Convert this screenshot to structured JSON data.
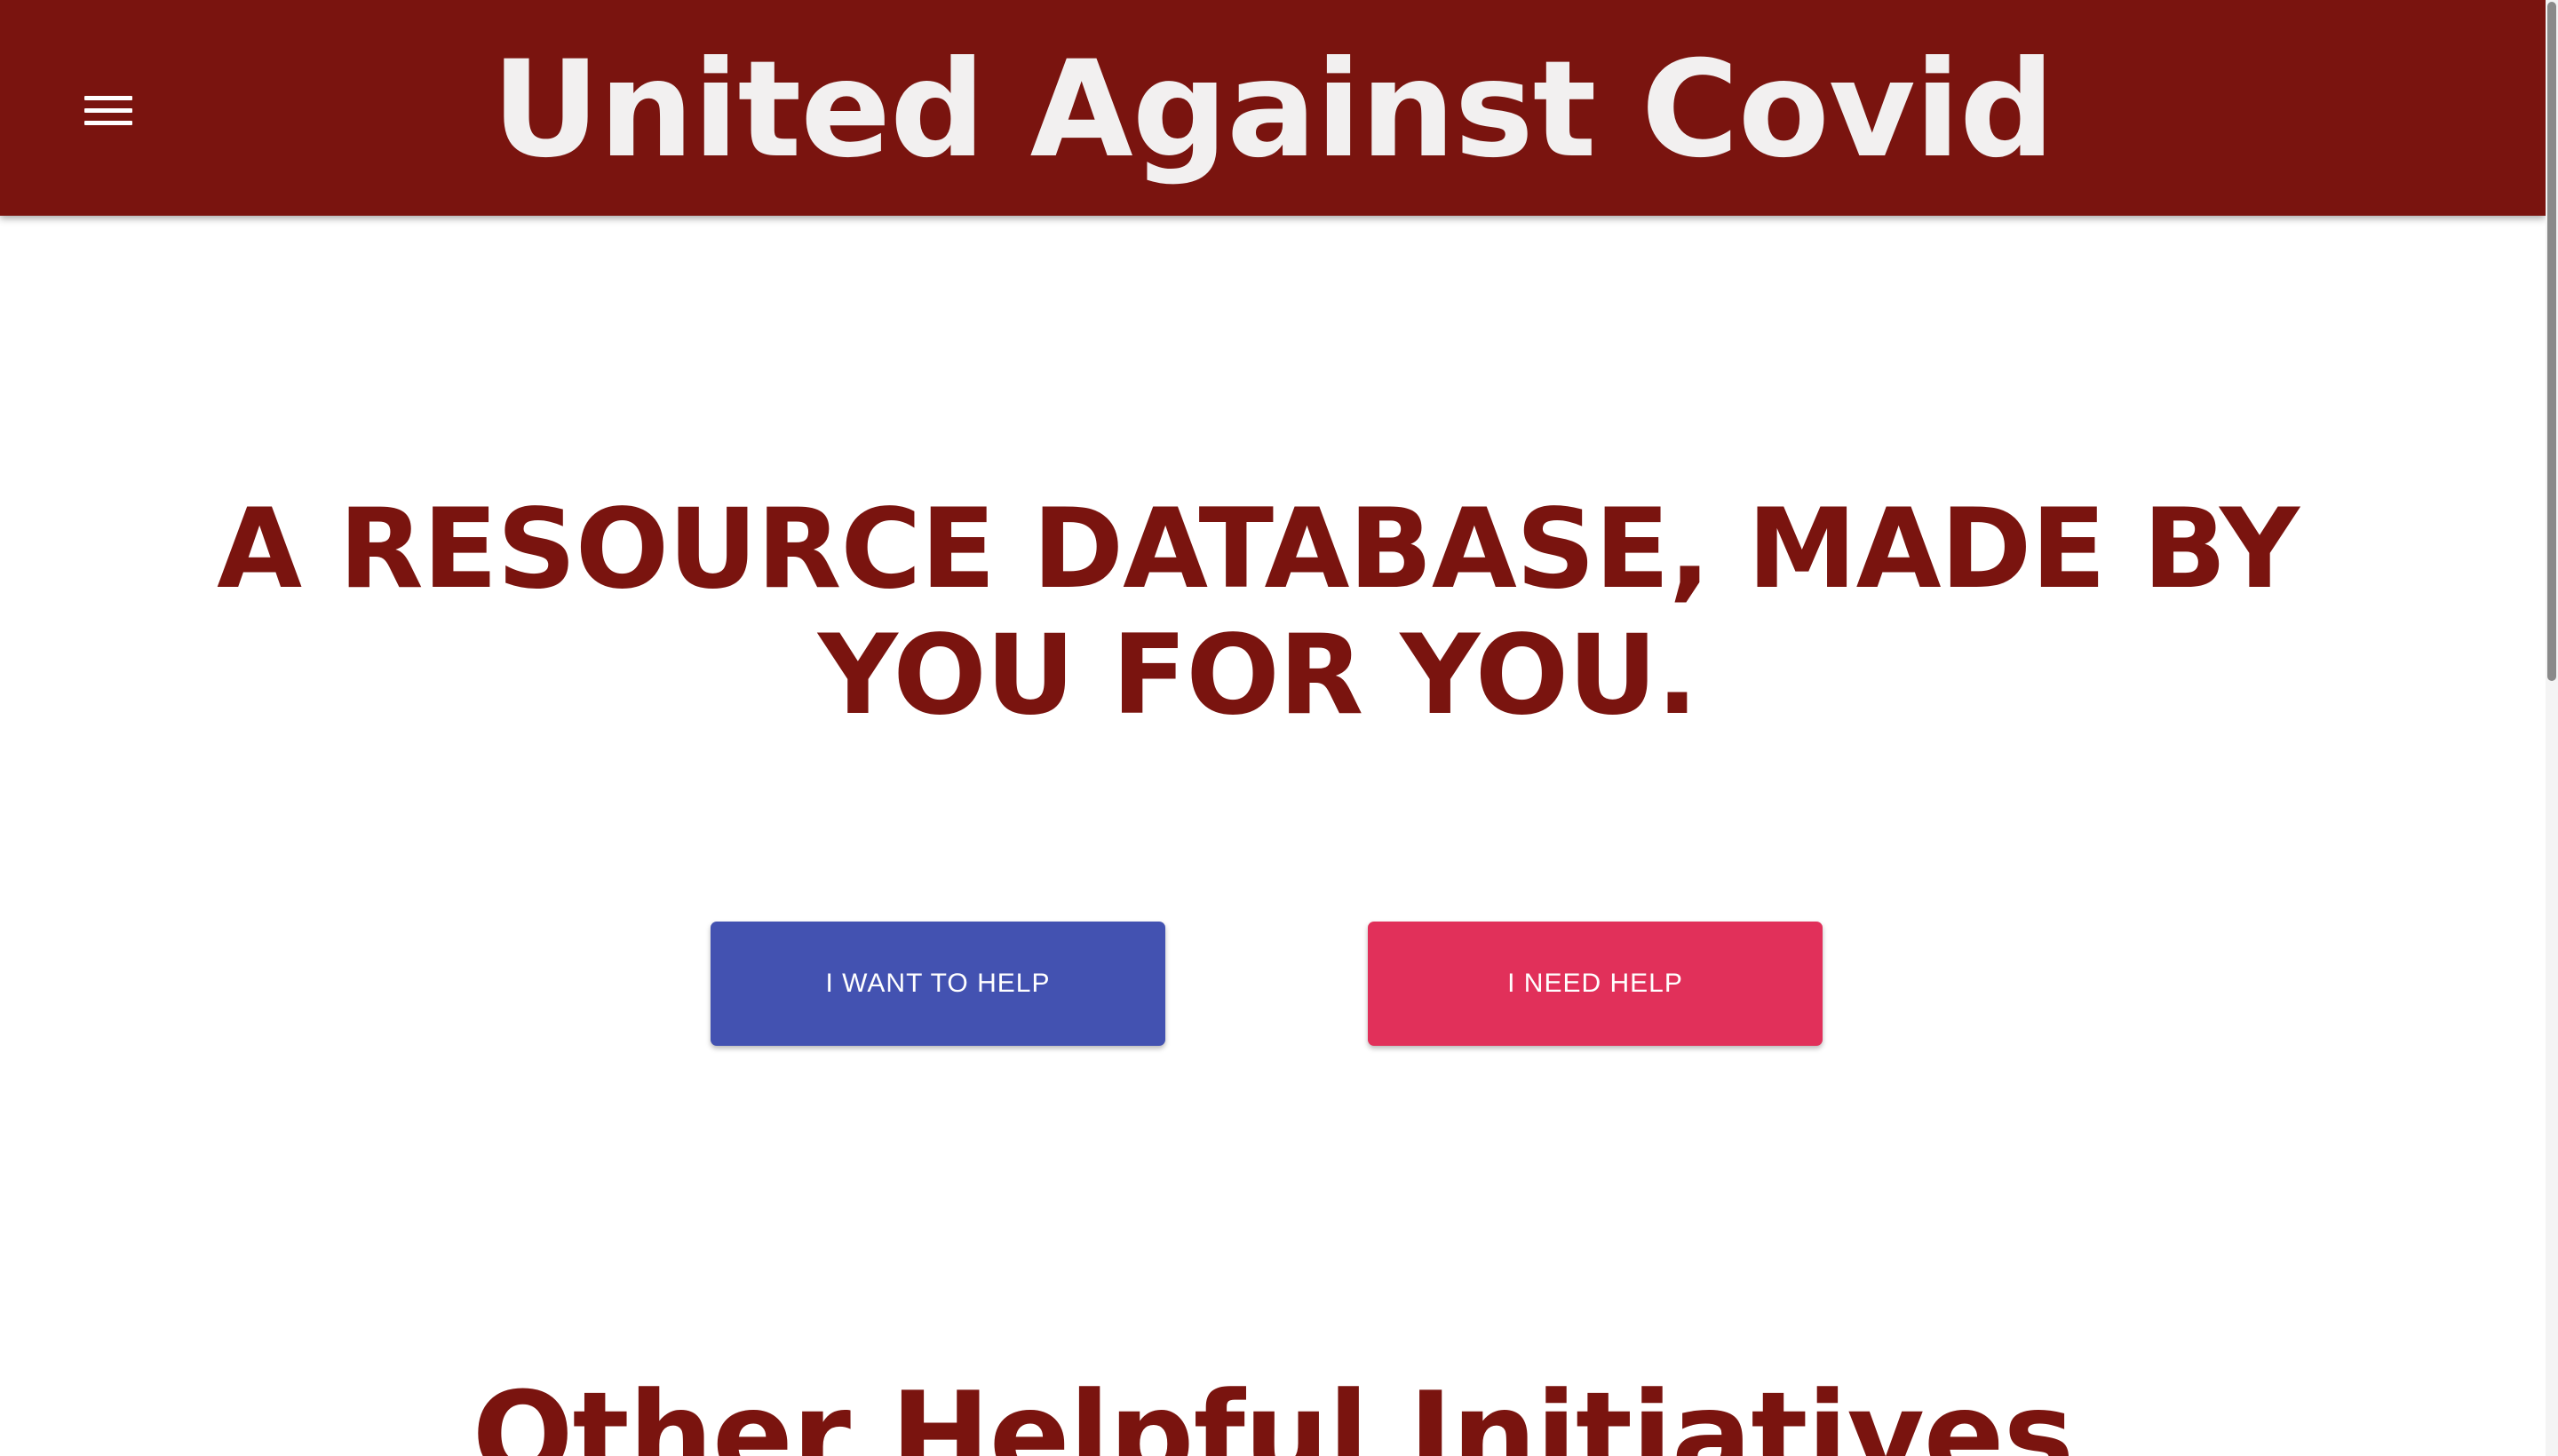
{
  "app_bar": {
    "title": "United Against Covid",
    "menu_icon": "menu-icon",
    "color": "#7a140f"
  },
  "hero": {
    "heading": "A RESOURCE DATABASE, MADE BY YOU FOR YOU."
  },
  "actions": {
    "want_help_label": "I WANT TO HELP",
    "want_help_color": "#4352b1",
    "need_help_label": "I NEED HELP",
    "need_help_color": "#e1305a"
  },
  "sections": {
    "other_initiatives_heading": "Other Helpful Initiatives"
  }
}
